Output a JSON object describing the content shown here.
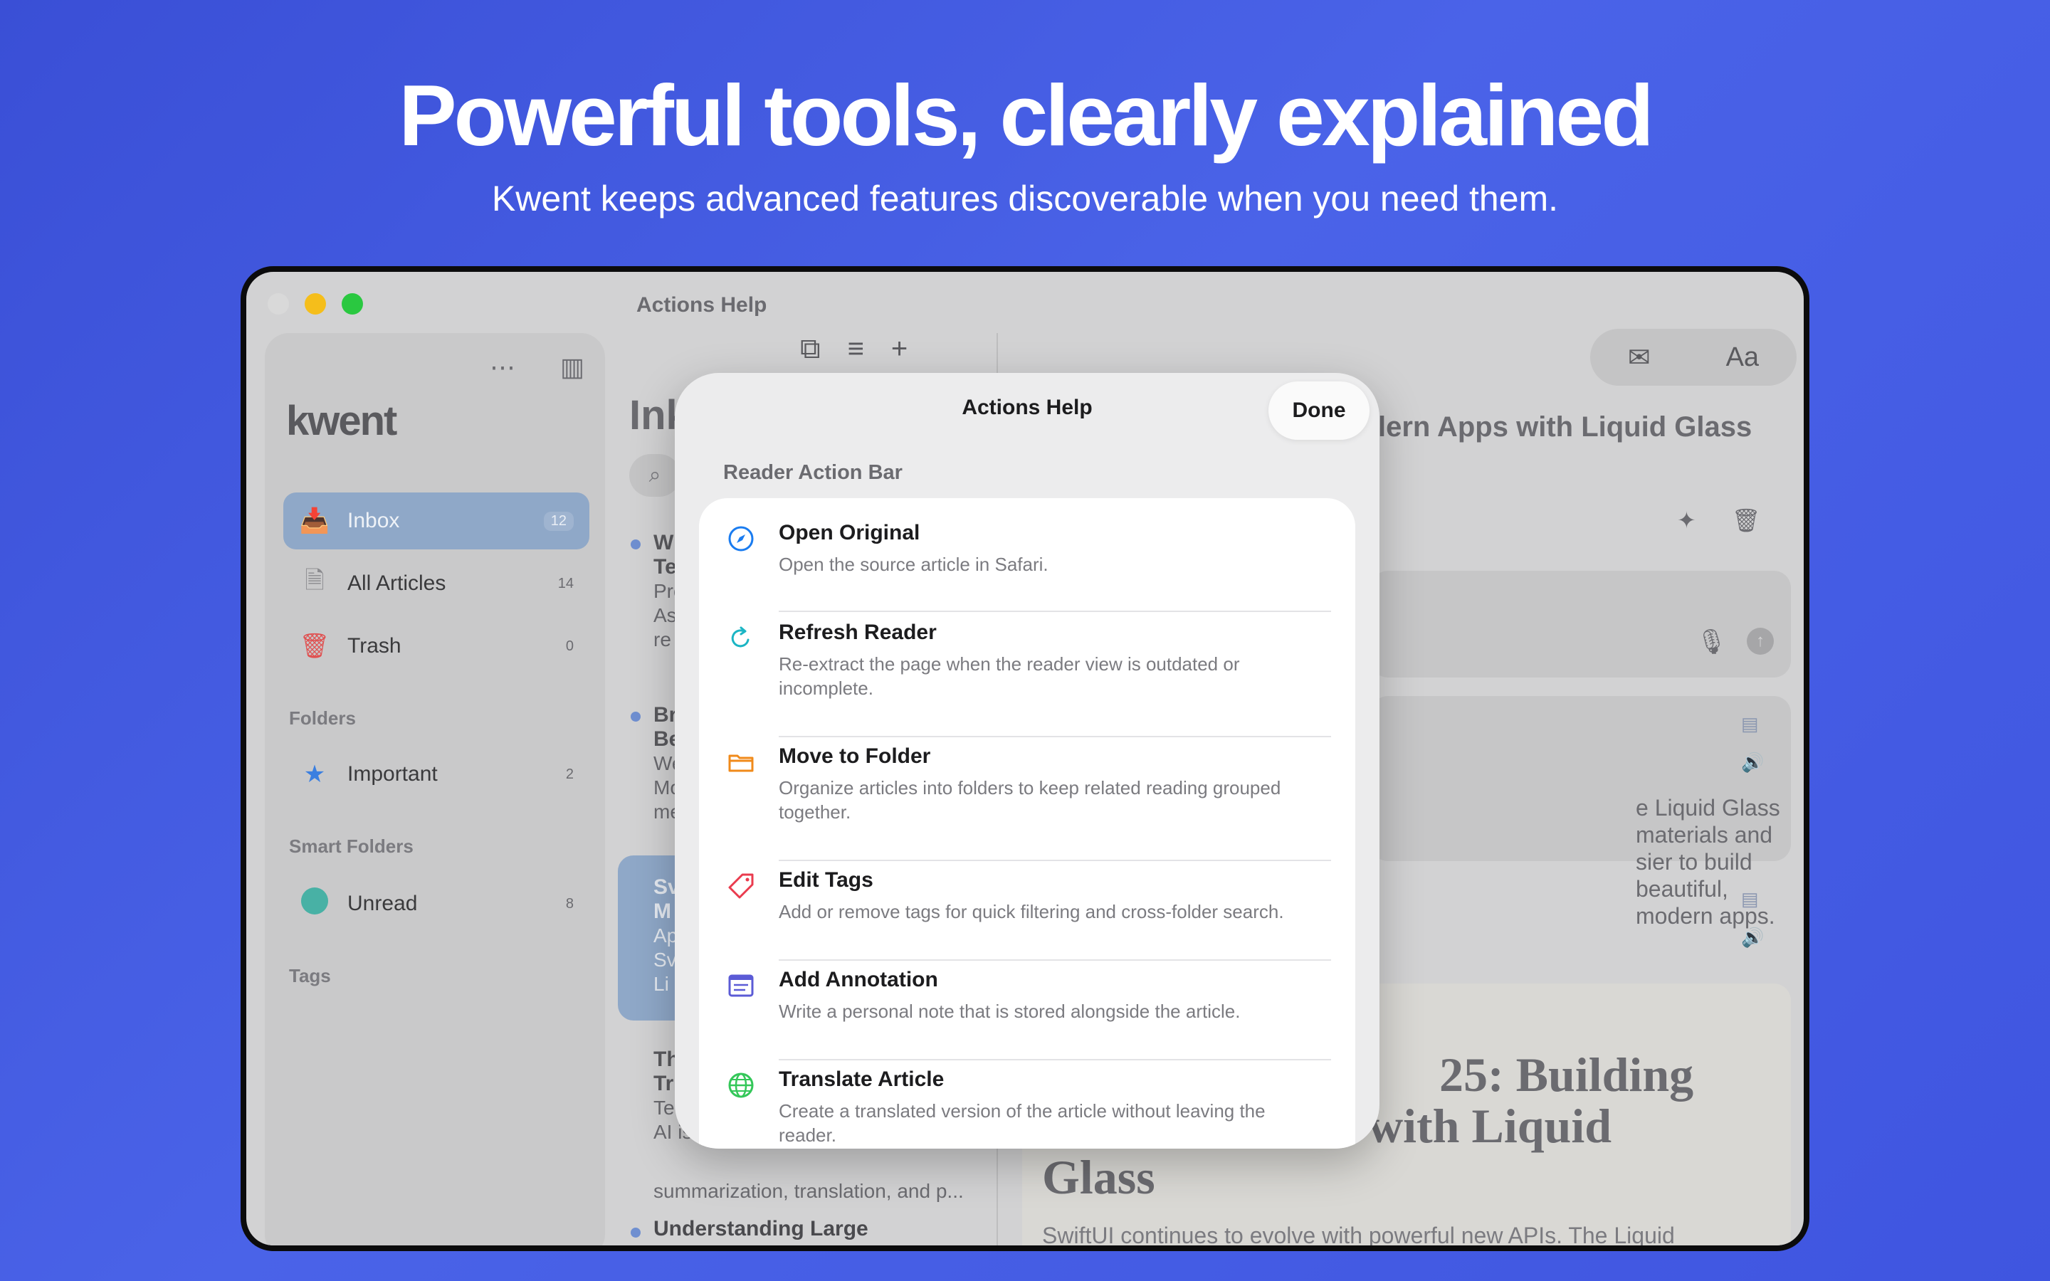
{
  "hero": {
    "title": "Powerful tools, clearly explained",
    "subtitle": "Kwent keeps advanced features discoverable when you need them."
  },
  "window": {
    "title": "Actions Help"
  },
  "sidebar": {
    "logo": "kwent",
    "items": [
      {
        "label": "Inbox",
        "count": "12",
        "icon": "inbox-icon"
      },
      {
        "label": "All Articles",
        "count": "14",
        "icon": "document-icon"
      },
      {
        "label": "Trash",
        "count": "0",
        "icon": "trash-icon"
      }
    ],
    "folders_header": "Folders",
    "folders": [
      {
        "label": "Important",
        "count": "2",
        "icon": "star-icon"
      }
    ],
    "smart_header": "Smart Folders",
    "smart": [
      {
        "label": "Unread",
        "count": "8",
        "icon": "circle-icon"
      }
    ],
    "tags_header": "Tags"
  },
  "middle": {
    "heading_fragment": "Ink",
    "fragments": [
      "W",
      "Te",
      "Pro",
      "As",
      "re",
      "Br",
      "Be",
      "We",
      "Mo",
      "me",
      "Sv",
      "M",
      "Ap",
      "Sv",
      "Li",
      "Th",
      "Tr",
      "Tec",
      "AI is"
    ],
    "line": "summarization, translation, and p...",
    "bottom_item": "Understanding Large"
  },
  "right": {
    "title_fragment": "lern Apps with Liquid Glass",
    "card_text_1": "e Liquid Glass materials and",
    "card_text_2": "sier to build beautiful, modern apps.",
    "article_title_1": "25: Building",
    "article_title_2": "with Liquid",
    "article_title_3": "Glass",
    "article_body": "SwiftUI continues to evolve with powerful new APIs. The Liquid",
    "aa_label": "Aa"
  },
  "modal": {
    "title": "Actions Help",
    "done": "Done",
    "section": "Reader Action Bar",
    "rows": [
      {
        "title": "Open Original",
        "desc": "Open the source article in Safari.",
        "icon": "compass-icon",
        "color": "#1a7cf0"
      },
      {
        "title": "Refresh Reader",
        "desc": "Re-extract the page when the reader view is outdated or incomplete.",
        "icon": "refresh-icon",
        "color": "#1bb5c4"
      },
      {
        "title": "Move to Folder",
        "desc": "Organize articles into folders to keep related reading grouped together.",
        "icon": "folder-icon",
        "color": "#f08a1a"
      },
      {
        "title": "Edit Tags",
        "desc": "Add or remove tags for quick filtering and cross-folder search.",
        "icon": "tag-icon",
        "color": "#ea3b4e"
      },
      {
        "title": "Add Annotation",
        "desc": "Write a personal note that is stored alongside the article.",
        "icon": "note-icon",
        "color": "#5b5bd6"
      },
      {
        "title": "Translate Article",
        "desc": "Create a translated version of the article without leaving the reader.",
        "icon": "globe-icon",
        "color": "#34c759"
      }
    ]
  }
}
